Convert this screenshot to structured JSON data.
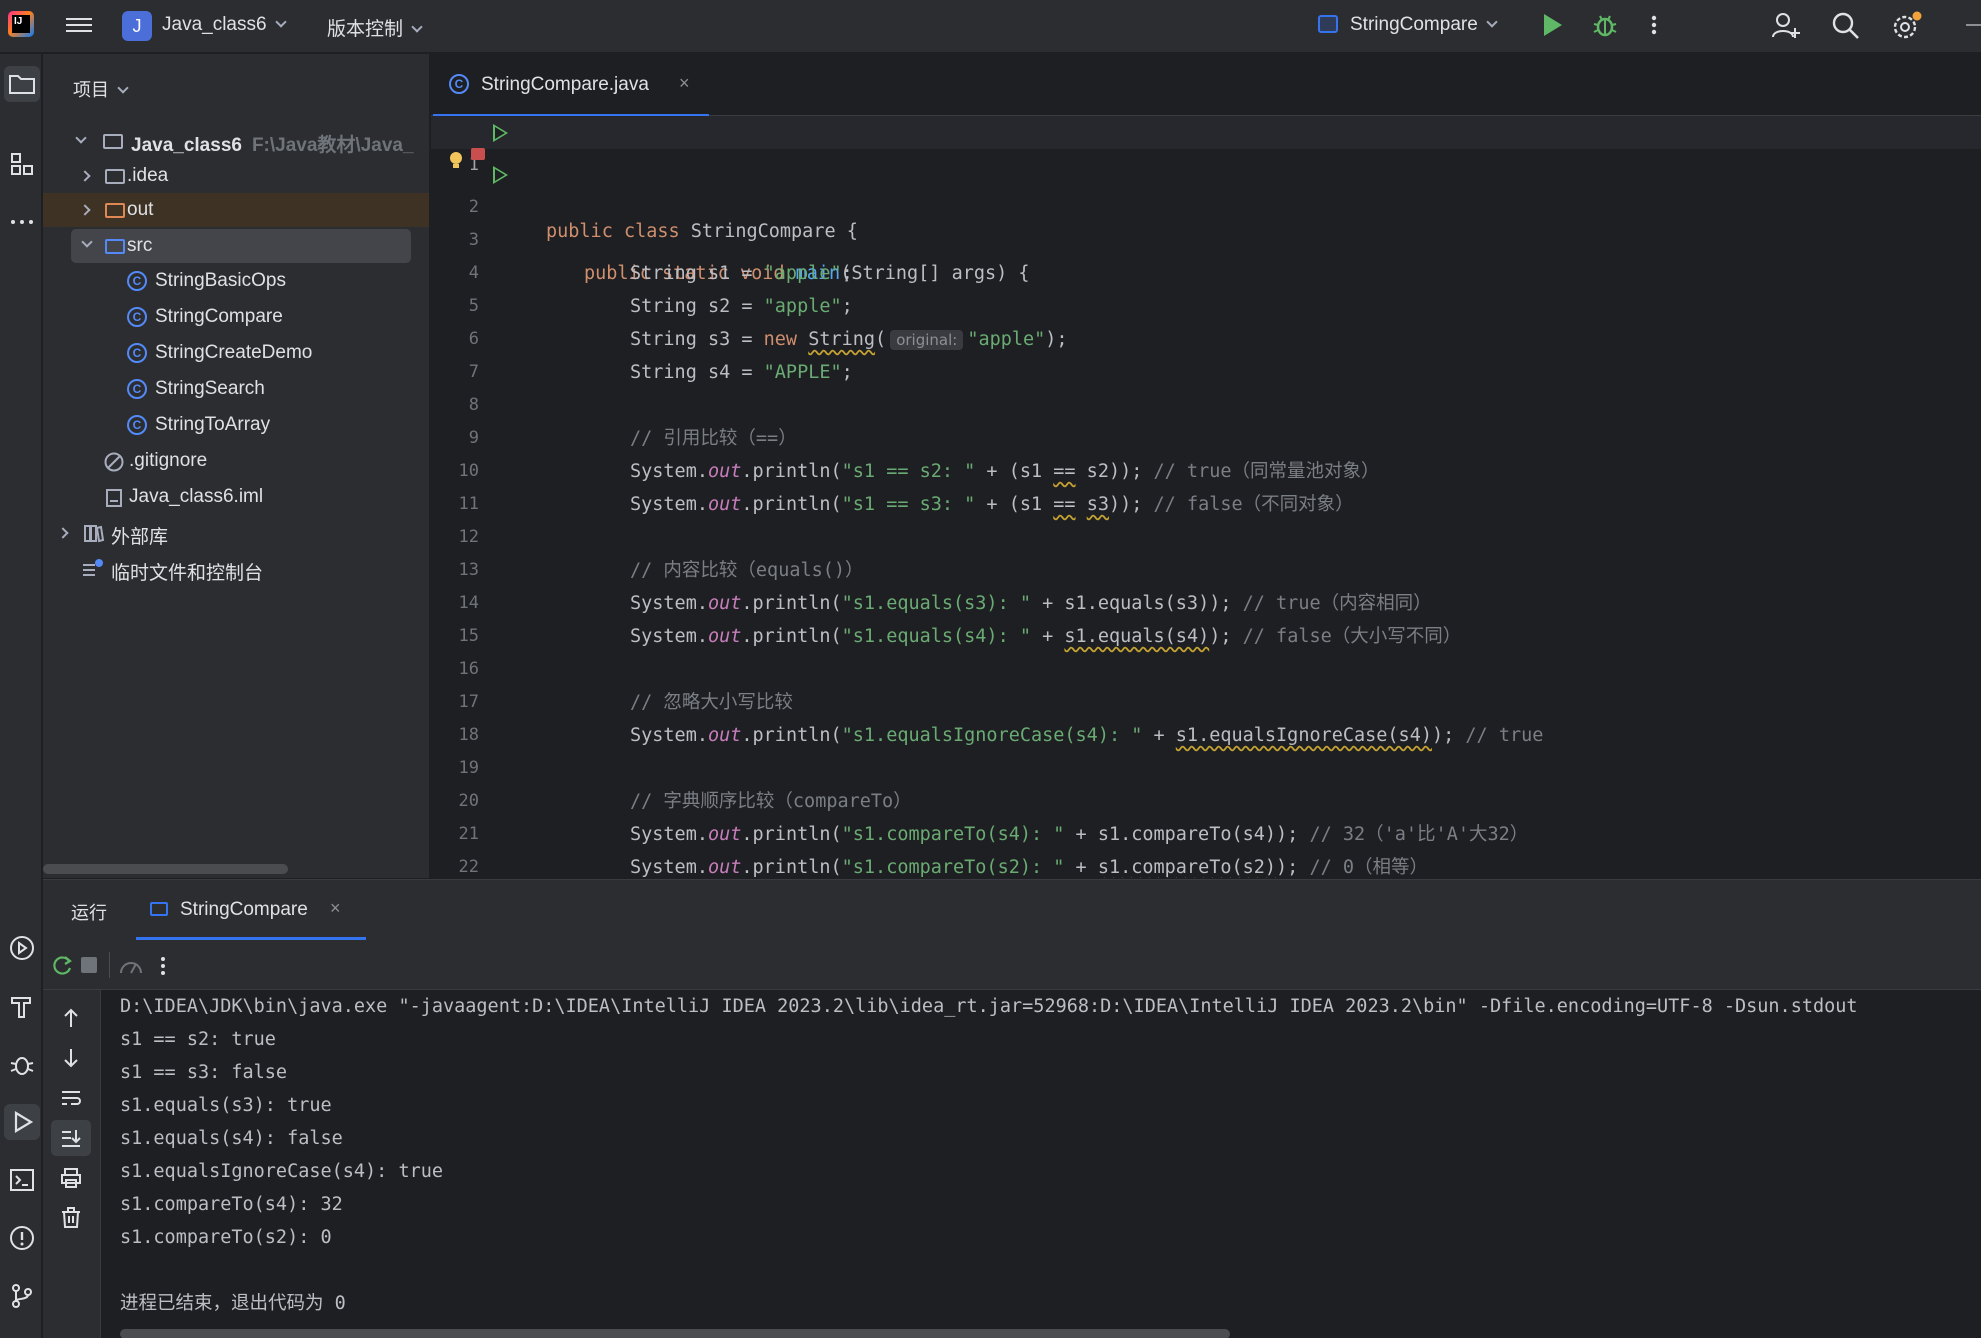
{
  "topbar": {
    "project_badge": "J",
    "project_name": "Java_class6",
    "vcs_label": "版本控制",
    "run_config": "StringCompare"
  },
  "project_panel": {
    "header": "项目",
    "root_name": "Java_class6",
    "root_path": "F:\\Java教材\\Java_",
    "items": {
      "idea": ".idea",
      "out": "out",
      "src": "src",
      "c1": "StringBasicOps",
      "c2": "StringCompare",
      "c3": "StringCreateDemo",
      "c4": "StringSearch",
      "c5": "StringToArray",
      "gitignore": ".gitignore",
      "iml": "Java_class6.iml",
      "extlibs": "外部库",
      "scratches": "临时文件和控制台"
    }
  },
  "editor": {
    "tab_label": "StringCompare.java",
    "tab_close": "×",
    "line_numbers": [
      "1",
      "2",
      "3",
      "4",
      "5",
      "6",
      "7",
      "8",
      "9",
      "10",
      "11",
      "12",
      "13",
      "14",
      "15",
      "16",
      "17",
      "18",
      "19",
      "20",
      "21",
      "22"
    ],
    "inlay_hint": "original:",
    "code": {
      "l1": [
        "public class ",
        "StringCompare {"
      ],
      "l2": [
        "public static void ",
        "main",
        "(String[] args) {"
      ],
      "l3": [
        "String s1 = ",
        "\"apple\"",
        ";"
      ],
      "l4": [
        "String s2 = ",
        "\"apple\"",
        ";"
      ],
      "l5": [
        "String s3 = ",
        "new ",
        "String",
        "(",
        "\"apple\"",
        ");"
      ],
      "l6": [
        "String s4 = ",
        "\"APPLE\"",
        ";"
      ],
      "l8": "// 引用比较（==）",
      "l9": [
        "System.",
        "out",
        ".println(",
        "\"s1 == s2: \"",
        " + (s1 ",
        "==",
        " s2)); ",
        "// true（同常量池对象）"
      ],
      "l10": [
        "System.",
        "out",
        ".println(",
        "\"s1 == s3: \"",
        " + (s1 ",
        "==",
        " ",
        "s3",
        ")); ",
        "// false（不同对象）"
      ],
      "l12": "// 内容比较（equals()）",
      "l13": [
        "System.",
        "out",
        ".println(",
        "\"s1.equals(s3): \"",
        " + s1.equals(s3)); ",
        "// true（内容相同）"
      ],
      "l14": [
        "System.",
        "out",
        ".println(",
        "\"s1.equals(s4): \"",
        " + ",
        "s1.equals(s4)",
        "); ",
        "// false（大小写不同）"
      ],
      "l16": "// 忽略大小写比较",
      "l17": [
        "System.",
        "out",
        ".println(",
        "\"s1.equalsIgnoreCase(s4): \"",
        " + ",
        "s1.equalsIgnoreCase(s4)",
        "); ",
        "// true"
      ],
      "l19": "// 字典顺序比较（compareTo）",
      "l20": [
        "System.",
        "out",
        ".println(",
        "\"s1.compareTo(s4): \"",
        " + s1.compareTo(s4)); ",
        "// 32（'a'比'A'大32）"
      ],
      "l21": [
        "System.",
        "out",
        ".println(",
        "\"s1.compareTo(s2): \"",
        " + ",
        "s1.compareTo(s2)",
        "); ",
        "// 0（相等）"
      ],
      "l22": "}"
    }
  },
  "run_panel": {
    "title": "运行",
    "tab_label": "StringCompare",
    "tab_close": "×",
    "console": [
      "D:\\IDEA\\JDK\\bin\\java.exe \"-javaagent:D:\\IDEA\\IntelliJ IDEA 2023.2\\lib\\idea_rt.jar=52968:D:\\IDEA\\IntelliJ IDEA 2023.2\\bin\" -Dfile.encoding=UTF-8 -Dsun.stdout",
      "s1 == s2: true",
      "s1 == s3: false",
      "s1.equals(s3): true",
      "s1.equals(s4): false",
      "s1.equalsIgnoreCase(s4): true",
      "s1.compareTo(s4): 32",
      "s1.compareTo(s2): 0",
      "",
      "进程已结束，退出代码为 0"
    ]
  },
  "colors": {
    "accent": "#3574f0",
    "run_green": "#5fb865",
    "keyword": "#cf8e6d",
    "string": "#6aab73",
    "method": "#56a8f5",
    "static_field": "#c77dbb",
    "comment": "#7a7e85"
  }
}
